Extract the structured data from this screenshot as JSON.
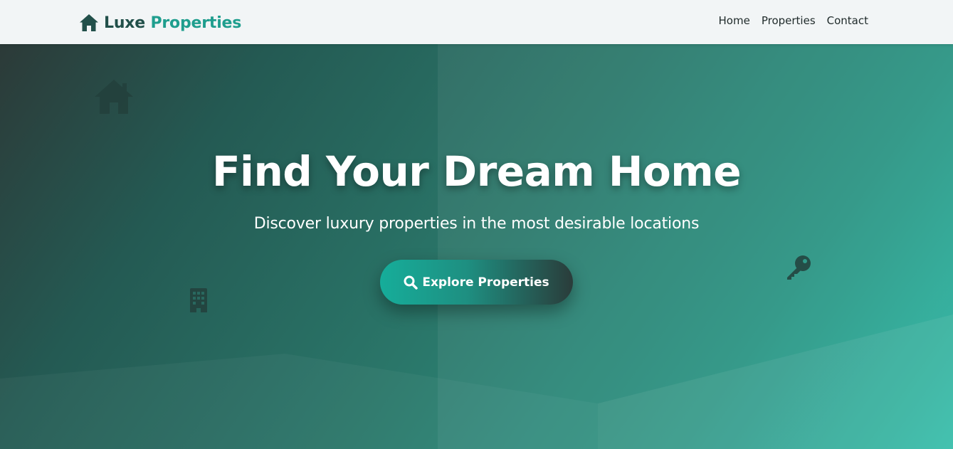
{
  "nav": {
    "brand": {
      "icon": "house-icon",
      "word1": "Luxe",
      "word2": "Properties"
    },
    "links": [
      {
        "label": "Home"
      },
      {
        "label": "Properties"
      },
      {
        "label": "Contact"
      }
    ]
  },
  "hero": {
    "title": "Find Your Dream Home",
    "subtitle": "Discover luxury properties in the most desirable locations",
    "cta": {
      "icon": "search-icon",
      "label": "Explore Properties"
    },
    "decorative_icons": [
      "house-icon",
      "building-icon",
      "key-icon"
    ]
  },
  "colors": {
    "brand_dark": "#22504a",
    "brand_accent": "#1f9e8e",
    "navbar_bg": "#f2f5f6",
    "hero_gradient_start": "#2c3a38",
    "hero_gradient_end": "#2bbaa6"
  }
}
